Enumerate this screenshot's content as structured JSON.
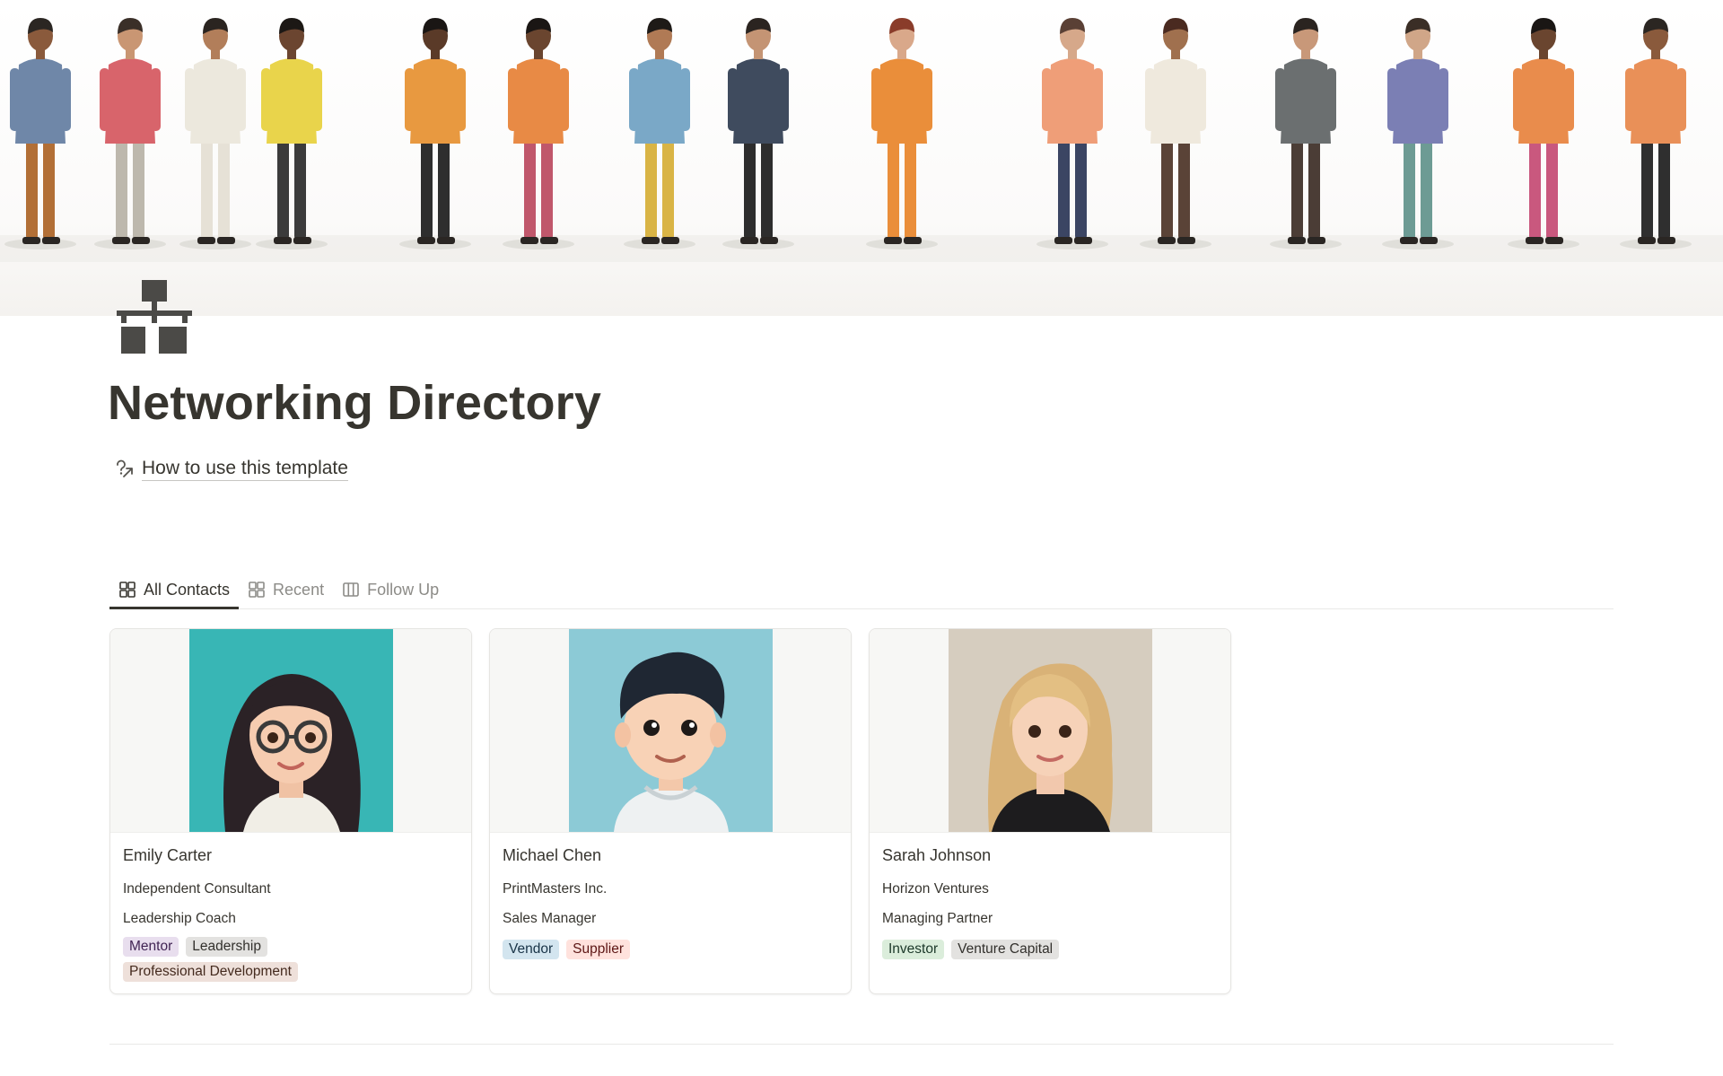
{
  "cover": {
    "alt_icon": "people-networking-illustration"
  },
  "page": {
    "icon": "org-chart-icon",
    "title": "Networking Directory",
    "howto_label": "How to use this template"
  },
  "tabs": [
    {
      "label": "All Contacts",
      "icon": "gallery-icon",
      "active": true
    },
    {
      "label": "Recent",
      "icon": "gallery-icon",
      "active": false
    },
    {
      "label": "Follow Up",
      "icon": "board-icon",
      "active": false
    }
  ],
  "contacts": [
    {
      "name": "Emily Carter",
      "company": "Independent Consultant",
      "role": "Leadership Coach",
      "tags": [
        {
          "label": "Mentor",
          "color": "purple"
        },
        {
          "label": "Leadership",
          "color": "gray"
        },
        {
          "label": "Professional Development",
          "color": "brown"
        }
      ],
      "avatar_bg": "#38b6b5"
    },
    {
      "name": "Michael Chen",
      "company": "PrintMasters Inc.",
      "role": "Sales Manager",
      "tags": [
        {
          "label": "Vendor",
          "color": "blue"
        },
        {
          "label": "Supplier",
          "color": "red"
        }
      ],
      "avatar_bg": "#8ccad6"
    },
    {
      "name": "Sarah Johnson",
      "company": "Horizon Ventures",
      "role": "Managing Partner",
      "tags": [
        {
          "label": "Investor",
          "color": "green"
        },
        {
          "label": "Venture Capital",
          "color": "gray"
        }
      ],
      "avatar_bg": "#d6cdbf"
    }
  ]
}
